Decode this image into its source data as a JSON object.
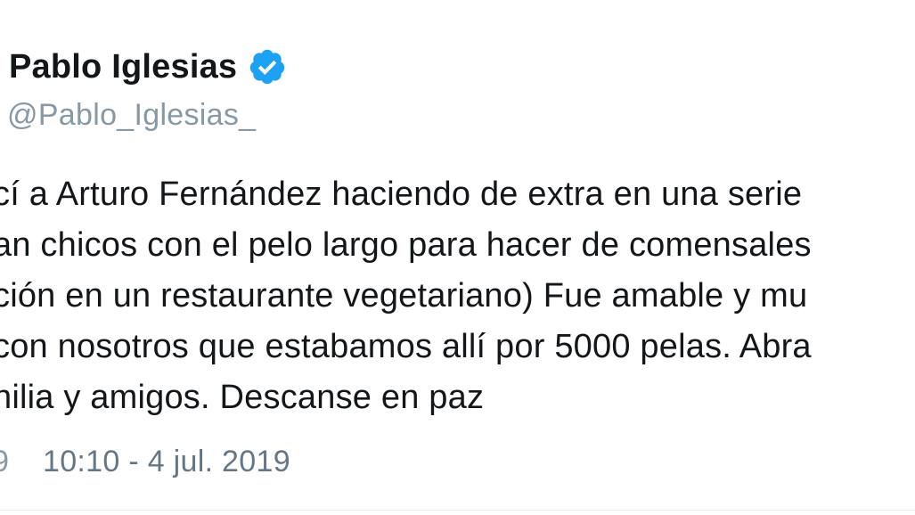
{
  "author": {
    "name": "Pablo Iglesias",
    "handle": "@Pablo_Iglesias_",
    "verified": true
  },
  "tweet": {
    "lines": [
      "cí a Arturo Fernández haciendo de extra en una serie",
      "an chicos con el pelo largo para hacer de comensales",
      "ción en un restaurante vegetariano) Fue amable y mu",
      "con nosotros que estabamos allí por 5000 pelas. Abra",
      "nilia y amigos. Descanse en paz"
    ]
  },
  "meta": {
    "icon": "info-icon",
    "icon_glyph": "9",
    "timestamp": "10:10 - 4 jul. 2019"
  },
  "colors": {
    "text": "#14171a",
    "secondary": "#8899a6",
    "verified": "#1da1f2"
  }
}
